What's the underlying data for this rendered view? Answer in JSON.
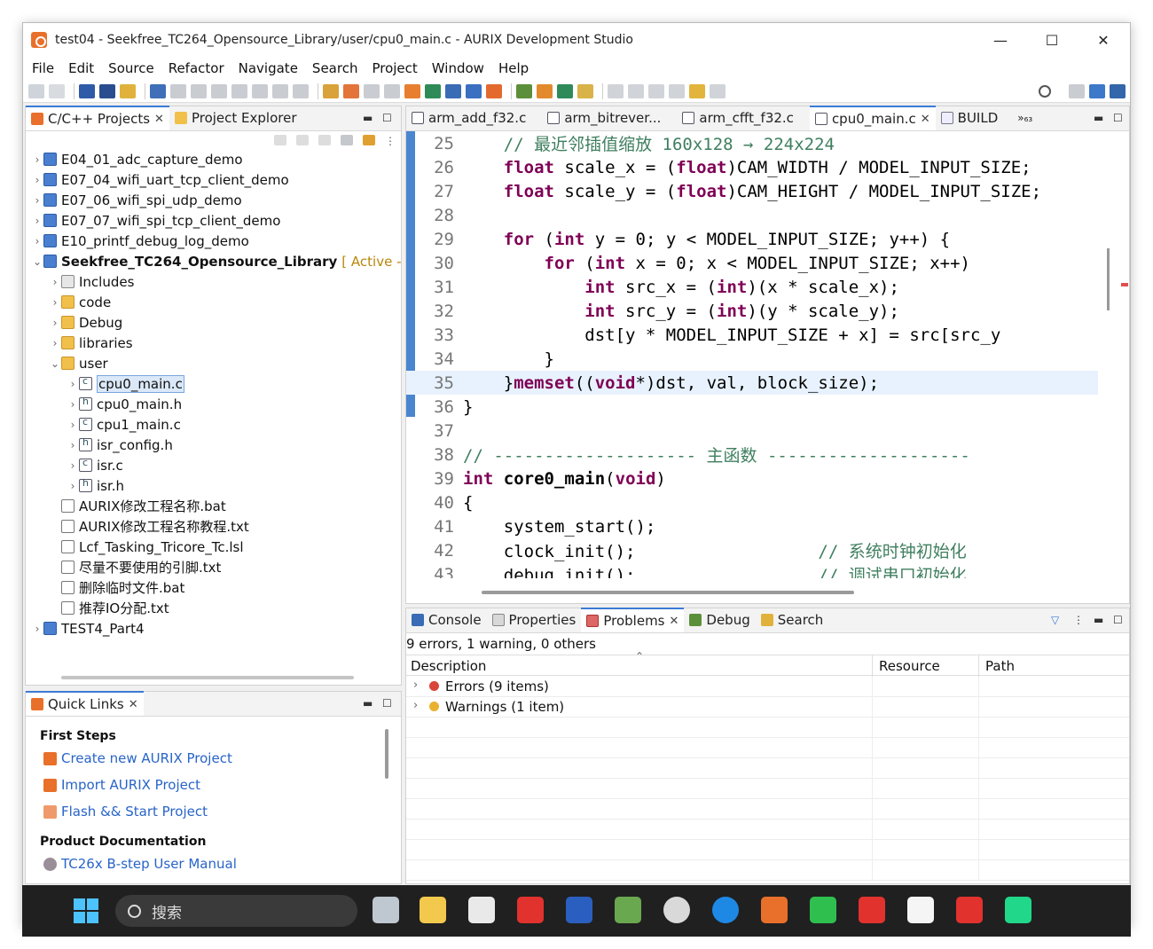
{
  "window": {
    "title": "test04 - Seekfree_TC264_Opensource_Library/user/cpu0_main.c - AURIX Development Studio",
    "minimize": "—",
    "maximize": "☐",
    "close": "✕"
  },
  "menu": [
    "File",
    "Edit",
    "Source",
    "Refactor",
    "Navigate",
    "Search",
    "Project",
    "Window",
    "Help"
  ],
  "left_panel": {
    "tabs": [
      {
        "label": "C/C++ Projects",
        "closable": "✕"
      },
      {
        "label": "Project Explorer"
      }
    ],
    "tree": [
      {
        "label": "E04_01_adc_capture_demo",
        "icon": "project-icon",
        "arrow": "›",
        "level": 0
      },
      {
        "label": "E07_04_wifi_uart_tcp_client_demo",
        "icon": "project-icon",
        "arrow": "›",
        "level": 0
      },
      {
        "label": "E07_06_wifi_spi_udp_demo",
        "icon": "project-icon",
        "arrow": "›",
        "level": 0
      },
      {
        "label": "E07_07_wifi_spi_tcp_client_demo",
        "icon": "project-icon",
        "arrow": "›",
        "level": 0
      },
      {
        "label": "E10_printf_debug_log_demo",
        "icon": "project-icon",
        "arrow": "›",
        "level": 0
      },
      {
        "label": "Seekfree_TC264_Opensource_Library",
        "suffix": "[ Active - Debug ]",
        "icon": "project-icon",
        "arrow": "⌄",
        "level": 0,
        "bold": true
      },
      {
        "label": "Includes",
        "icon": "includes-icon",
        "arrow": "›",
        "level": 1
      },
      {
        "label": "code",
        "icon": "folder-icon",
        "arrow": "›",
        "level": 1
      },
      {
        "label": "Debug",
        "icon": "folder-icon",
        "arrow": "›",
        "level": 1
      },
      {
        "label": "libraries",
        "icon": "folder-icon",
        "arrow": "›",
        "level": 1
      },
      {
        "label": "user",
        "icon": "folder-icon",
        "arrow": "⌄",
        "level": 1
      },
      {
        "label": "cpu0_main.c",
        "icon": "c-file-icon",
        "arrow": "›",
        "level": 2,
        "selected": true
      },
      {
        "label": "cpu0_main.h",
        "icon": "h-file-icon",
        "arrow": "›",
        "level": 2
      },
      {
        "label": "cpu1_main.c",
        "icon": "c-file-icon",
        "arrow": "›",
        "level": 2
      },
      {
        "label": "isr_config.h",
        "icon": "h-file-icon",
        "arrow": "›",
        "level": 2
      },
      {
        "label": "isr.c",
        "icon": "c-file-icon",
        "arrow": "›",
        "level": 2
      },
      {
        "label": "isr.h",
        "icon": "h-file-icon",
        "arrow": "›",
        "level": 2
      },
      {
        "label": "AURIX修改工程名称.bat",
        "icon": "file-icon",
        "arrow": "",
        "level": 1
      },
      {
        "label": "AURIX修改工程名称教程.txt",
        "icon": "file-icon",
        "arrow": "",
        "level": 1
      },
      {
        "label": "Lcf_Tasking_Tricore_Tc.lsl",
        "icon": "file-icon",
        "arrow": "",
        "level": 1
      },
      {
        "label": "尽量不要使用的引脚.txt",
        "icon": "file-icon",
        "arrow": "",
        "level": 1
      },
      {
        "label": "删除临时文件.bat",
        "icon": "file-icon",
        "arrow": "",
        "level": 1
      },
      {
        "label": "推荐IO分配.txt",
        "icon": "file-icon",
        "arrow": "",
        "level": 1
      },
      {
        "label": "TEST4_Part4",
        "icon": "project-icon",
        "arrow": "›",
        "level": 0
      }
    ]
  },
  "quick_links": {
    "tab": "Quick Links",
    "close": "✕",
    "sections": [
      {
        "heading": "First Steps",
        "links": [
          "Create new AURIX Project",
          "Import AURIX Project",
          "Flash && Start Project"
        ]
      },
      {
        "heading": "Product Documentation",
        "links": [
          "TC26x B-step User Manual"
        ]
      }
    ]
  },
  "editor": {
    "tabs": [
      {
        "label": "arm_add_f32.c"
      },
      {
        "label": "arm_bitrever..."
      },
      {
        "label": "arm_cfft_f32.c"
      },
      {
        "label": "cpu0_main.c",
        "active": true,
        "close": "✕"
      },
      {
        "label": "BUILD"
      }
    ],
    "overflow": "»₆₃",
    "lines": [
      {
        "n": "25",
        "code": [
          {
            "t": "    "
          },
          {
            "t": "// 最近邻插值缩放 160x128 → 224x224",
            "c": "cm"
          }
        ]
      },
      {
        "n": "26",
        "code": [
          {
            "t": "    "
          },
          {
            "t": "float",
            "c": "kw"
          },
          {
            "t": " scale_x = ("
          },
          {
            "t": "float",
            "c": "kw"
          },
          {
            "t": ")CAM_WIDTH / MODEL_INPUT_SIZE;"
          }
        ]
      },
      {
        "n": "27",
        "code": [
          {
            "t": "    "
          },
          {
            "t": "float",
            "c": "kw"
          },
          {
            "t": " scale_y = ("
          },
          {
            "t": "float",
            "c": "kw"
          },
          {
            "t": ")CAM_HEIGHT / MODEL_INPUT_SIZE;"
          }
        ]
      },
      {
        "n": "28",
        "code": []
      },
      {
        "n": "29",
        "code": [
          {
            "t": "    "
          },
          {
            "t": "for",
            "c": "kw"
          },
          {
            "t": " ("
          },
          {
            "t": "int",
            "c": "kw"
          },
          {
            "t": " y = 0; y < MODEL_INPUT_SIZE; y++) {"
          }
        ]
      },
      {
        "n": "30",
        "code": [
          {
            "t": "        "
          },
          {
            "t": "for",
            "c": "kw"
          },
          {
            "t": " ("
          },
          {
            "t": "int",
            "c": "kw"
          },
          {
            "t": " x = 0; x < MODEL_INPUT_SIZE; x++)"
          }
        ]
      },
      {
        "n": "31",
        "code": [
          {
            "t": "            "
          },
          {
            "t": "int",
            "c": "kw"
          },
          {
            "t": " src_x = ("
          },
          {
            "t": "int",
            "c": "kw"
          },
          {
            "t": ")(x * scale_x);"
          }
        ]
      },
      {
        "n": "32",
        "code": [
          {
            "t": "            "
          },
          {
            "t": "int",
            "c": "kw"
          },
          {
            "t": " src_y = ("
          },
          {
            "t": "int",
            "c": "kw"
          },
          {
            "t": ")(y * scale_y);"
          }
        ]
      },
      {
        "n": "33",
        "code": [
          {
            "t": "            dst[y * MODEL_INPUT_SIZE + x] = src[src_y"
          }
        ]
      },
      {
        "n": "34",
        "code": [
          {
            "t": "        }"
          }
        ]
      },
      {
        "n": "35",
        "code": [
          {
            "t": "    }"
          },
          {
            "t": "memset",
            "c": "kw"
          },
          {
            "t": "(("
          },
          {
            "t": "void",
            "c": "kw"
          },
          {
            "t": "*)dst, val, block_size);"
          }
        ],
        "highlight": true
      },
      {
        "n": "36",
        "code": [
          {
            "t": "}"
          }
        ]
      },
      {
        "n": "37",
        "code": []
      },
      {
        "n": "38",
        "code": [
          {
            "t": "// -------------------- 主函数 --------------------",
            "c": "cm"
          }
        ]
      },
      {
        "n": "39",
        "code": [
          {
            "t": "int",
            "c": "kw"
          },
          {
            "t": " "
          },
          {
            "t": "core0_main",
            "c": "fn"
          },
          {
            "t": "("
          },
          {
            "t": "void",
            "c": "kw"
          },
          {
            "t": ")"
          }
        ]
      },
      {
        "n": "40",
        "code": [
          {
            "t": "{"
          }
        ]
      },
      {
        "n": "41",
        "code": [
          {
            "t": "    system_start();"
          }
        ]
      },
      {
        "n": "42",
        "code": [
          {
            "t": "    clock_init();                  "
          },
          {
            "t": "// 系统时钟初始化",
            "c": "cm"
          }
        ]
      },
      {
        "n": "43",
        "code": [
          {
            "t": "    debug_init();                  "
          },
          {
            "t": "// 调试串口初始化",
            "c": "cm"
          }
        ]
      }
    ]
  },
  "bottom_panel": {
    "tabs": [
      {
        "label": "Console"
      },
      {
        "label": "Properties"
      },
      {
        "label": "Problems",
        "active": true,
        "close": "✕"
      },
      {
        "label": "Debug"
      },
      {
        "label": "Search"
      }
    ],
    "summary": "9 errors, 1 warning, 0 others",
    "columns": [
      "Description",
      "Resource",
      "Path"
    ],
    "rows": [
      {
        "label": "Errors (9 items)",
        "icon": "error-icon"
      },
      {
        "label": "Warnings (1 item)",
        "icon": "warning-icon"
      }
    ]
  },
  "taskbar": {
    "search_placeholder": "搜索"
  },
  "colors": {
    "accent": "#3b7bd4",
    "keyword": "#7f0055",
    "comment": "#3f7f5f",
    "link": "#2864c8",
    "taskbar": "#202020"
  }
}
